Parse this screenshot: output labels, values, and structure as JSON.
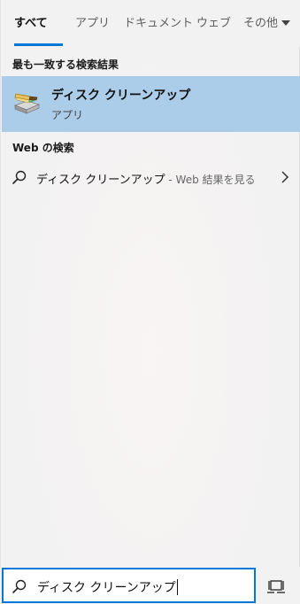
{
  "tabs": {
    "items": [
      {
        "label": "すべて",
        "active": true
      },
      {
        "label": "アプリ",
        "active": false
      },
      {
        "label": "ドキュメント",
        "active": false
      },
      {
        "label": "ウェブ",
        "active": false
      },
      {
        "label": "その他",
        "active": false,
        "has_dropdown": true
      }
    ]
  },
  "best_match": {
    "section_title": "最も一致する検索結果",
    "title": "ディスク クリーンアップ",
    "subtitle": "アプリ",
    "icon": "disk-cleanup-icon"
  },
  "web": {
    "section_title": "Web の検索",
    "query": "ディスク クリーンアップ",
    "suffix": " - Web 結果を見る",
    "icon": "search-icon"
  },
  "search_box": {
    "value": "ディスク クリーンアップ",
    "icon": "search-icon"
  },
  "colors": {
    "accent": "#0078d7",
    "selection": "#abcde9"
  }
}
